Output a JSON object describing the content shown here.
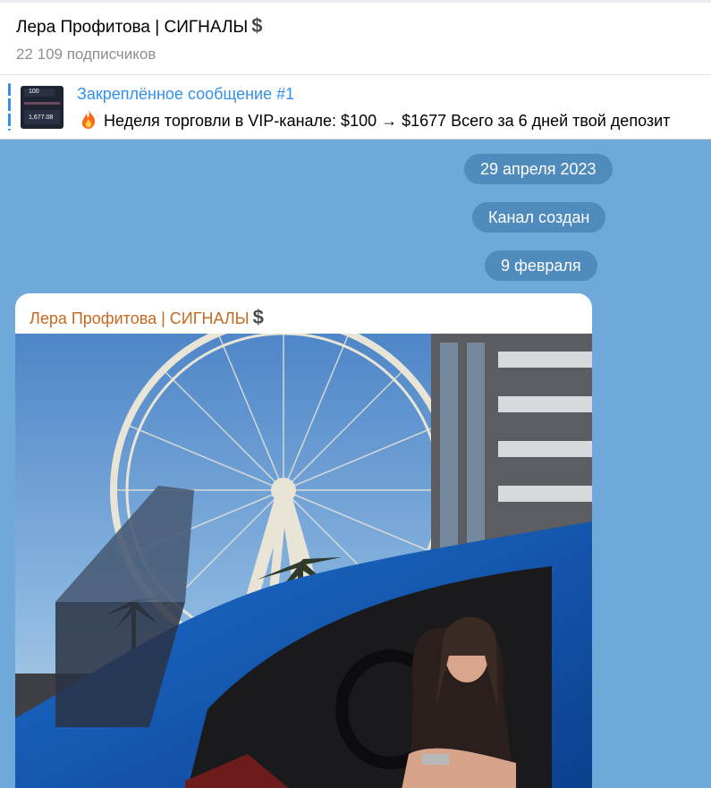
{
  "header": {
    "title": "Лера Профитова | СИГНАЛЫ",
    "title_emoji": "$",
    "subscribers": "22 109 подписчиков"
  },
  "pinned": {
    "label": "Закреплённое сообщение #1",
    "text": "Неделя торговли в VIP-канале: $100 → $1677  Всего за 6 дней твой депозит",
    "thumb_icon": "chart-thumbnail",
    "emoji_icon": "fire-icon"
  },
  "chat": {
    "dates": [
      {
        "label": "29 апреля 2023"
      },
      {
        "label": "Канал создан"
      },
      {
        "label": "9 февраля"
      }
    ],
    "message": {
      "author": "Лера Профитова | СИГНАЛЫ",
      "author_emoji": "$",
      "photo_description": "photo-ferris-wheel-car"
    }
  },
  "colors": {
    "accent": "#3390ec",
    "chat_bg": "#6fa9d9",
    "pill_bg": "#4f8bbd",
    "author_color": "#c7681f"
  }
}
